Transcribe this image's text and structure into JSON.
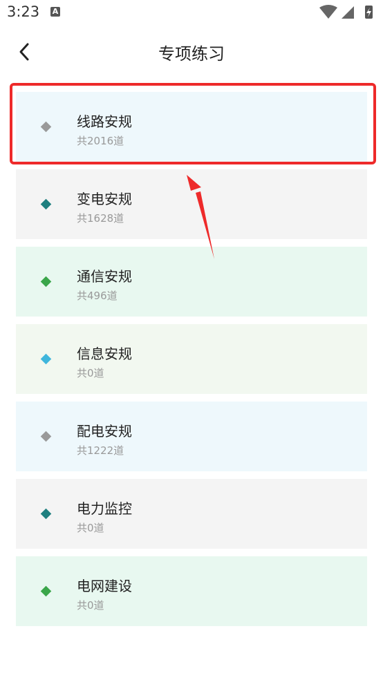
{
  "status_bar": {
    "time": "3:23",
    "notification_icon": "A"
  },
  "header": {
    "back_icon": "chevron-left-icon",
    "title": "专项练习"
  },
  "items": [
    {
      "title": "线路安规",
      "subtitle": "共2016道",
      "bg": "#eef8fc",
      "dot": "#9a9a9a"
    },
    {
      "title": "变电安规",
      "subtitle": "共1628道",
      "bg": "#f4f4f4",
      "dot": "#1e7f7f"
    },
    {
      "title": "通信安规",
      "subtitle": "共496道",
      "bg": "#e8f8f0",
      "dot": "#3aa64a"
    },
    {
      "title": "信息安规",
      "subtitle": "共0道",
      "bg": "#f2f8f0",
      "dot": "#3fb6dc"
    },
    {
      "title": "配电安规",
      "subtitle": "共1222道",
      "bg": "#eef8fc",
      "dot": "#9a9a9a"
    },
    {
      "title": "电力监控",
      "subtitle": "共0道",
      "bg": "#f4f4f4",
      "dot": "#1e7f7f"
    },
    {
      "title": "电网建设",
      "subtitle": "共0道",
      "bg": "#e8f8f0",
      "dot": "#3aa64a"
    }
  ],
  "annotation": {
    "highlight_color": "#ee2a2a"
  }
}
